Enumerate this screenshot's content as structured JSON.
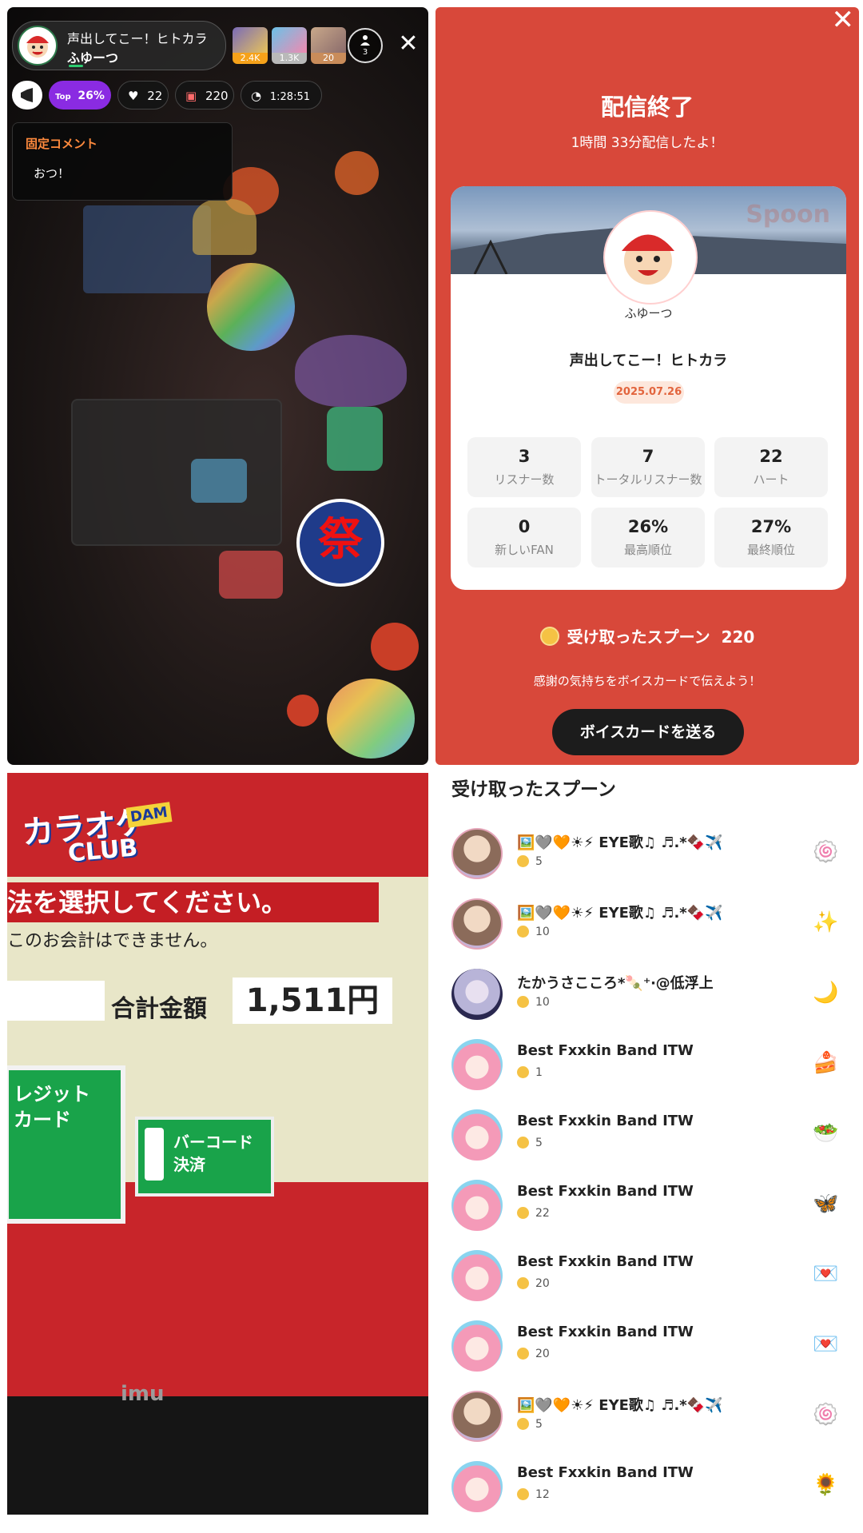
{
  "live": {
    "host_title": "声出してこー！ヒトカラ",
    "host_name": "ふゆーつ",
    "ranks": [
      {
        "value": "2.4K",
        "color": "#f6a21a"
      },
      {
        "value": "1.3K",
        "color": "#b9b9b9"
      },
      {
        "value": "20",
        "color": "#c98c5a"
      }
    ],
    "listener_count": "3",
    "badge_top_label": "Top",
    "badge_top_value": "26%",
    "hearts": "22",
    "gifts": "220",
    "elapsed": "1:28:51",
    "pinned_label": "固定コメント",
    "pinned_text": "おつ！"
  },
  "end": {
    "title": "配信終了",
    "subtitle": "1時間 33分配信したよ！",
    "watermark": "Spoon",
    "dj_name": "ふゆーつ",
    "cast_title": "声出してこー！ヒトカラ",
    "date": "2025.07.26",
    "stats": [
      {
        "value": "3",
        "label": "リスナー数"
      },
      {
        "value": "7",
        "label": "トータルリスナー数"
      },
      {
        "value": "22",
        "label": "ハート"
      },
      {
        "value": "0",
        "label": "新しいFAN"
      },
      {
        "value": "26%",
        "label": "最高順位"
      },
      {
        "value": "27%",
        "label": "最終順位"
      }
    ],
    "spoon_label": "受け取ったスプーン",
    "spoon_total": "220",
    "thanks": "感謝の気持ちをボイスカードで伝えよう！",
    "voice_card_button": "ボイスカードを送る",
    "bg_color": "#d8483a"
  },
  "photo": {
    "logo_line1": "カラオケ",
    "logo_line2": "CLUB",
    "logo_dam": "DAM",
    "header": "法を選択してください。",
    "note": "このお会計はできません。",
    "total_label": "合計金額",
    "amount": "1,511円",
    "credit_label": "レジット\nカード",
    "barcode_label": "バーコード\n決済",
    "monitor_brand": "imu"
  },
  "received": {
    "title": "受け取ったスプーン",
    "rows": [
      {
        "name": "🖼️🩶🧡☀︎⚡︎ EYE歌♫ ♬.*🍫✈️",
        "count": "5",
        "avatar": "girl",
        "gift": "🍥"
      },
      {
        "name": "🖼️🩶🧡☀︎⚡︎ EYE歌♫ ♬.*🍫✈️",
        "count": "10",
        "avatar": "girl",
        "gift": "✨"
      },
      {
        "name": "たかうさこころ*🍡⁺‧@低浮上",
        "count": "10",
        "avatar": "silver",
        "gift": "🌙"
      },
      {
        "name": "Best Fxxkin Band ITW",
        "count": "1",
        "avatar": "pink",
        "gift": "🍰"
      },
      {
        "name": "Best Fxxkin Band ITW",
        "count": "5",
        "avatar": "pink",
        "gift": "🥗"
      },
      {
        "name": "Best Fxxkin Band ITW",
        "count": "22",
        "avatar": "pink",
        "gift": "🦋"
      },
      {
        "name": "Best Fxxkin Band ITW",
        "count": "20",
        "avatar": "pink",
        "gift": "💌"
      },
      {
        "name": "Best Fxxkin Band ITW",
        "count": "20",
        "avatar": "pink",
        "gift": "💌"
      },
      {
        "name": "🖼️🩶🧡☀︎⚡︎ EYE歌♫ ♬.*🍫✈️",
        "count": "5",
        "avatar": "girl",
        "gift": "🍥"
      },
      {
        "name": "Best Fxxkin Band ITW",
        "count": "12",
        "avatar": "pink",
        "gift": "🌻"
      }
    ]
  }
}
